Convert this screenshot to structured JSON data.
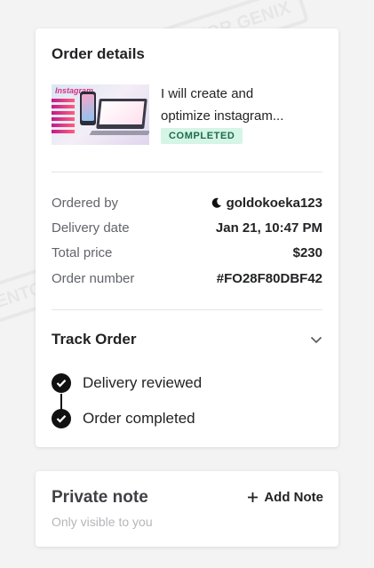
{
  "watermark": {
    "text": "MENTOR GENIX"
  },
  "order": {
    "title": "Order details",
    "gig": {
      "thumbnail_brand": "Instagram",
      "title_line1": "I will create and",
      "title_line2": "optimize instagram...",
      "status": "COMPLETED"
    },
    "details": {
      "ordered_by_label": "Ordered by",
      "ordered_by_value": "goldokoeka123",
      "delivery_date_label": "Delivery date",
      "delivery_date_value": "Jan 21, 10:47 PM",
      "total_price_label": "Total price",
      "total_price_value": "$230",
      "order_number_label": "Order number",
      "order_number_value": "#FO28F80DBF42"
    },
    "track": {
      "title": "Track Order",
      "steps": [
        {
          "label": "Delivery reviewed"
        },
        {
          "label": "Order completed"
        }
      ]
    }
  },
  "note": {
    "title": "Private note",
    "subtitle": "Only visible to you",
    "add_label": "Add Note"
  },
  "colors": {
    "badge_bg": "#d5f5e6",
    "badge_text": "#1d6b4f",
    "text_primary": "#222325",
    "text_secondary": "#62646a"
  },
  "icons": {
    "user": "moon-icon",
    "expand": "chevron-down-icon",
    "step": "check-circle-icon",
    "add": "plus-icon"
  }
}
